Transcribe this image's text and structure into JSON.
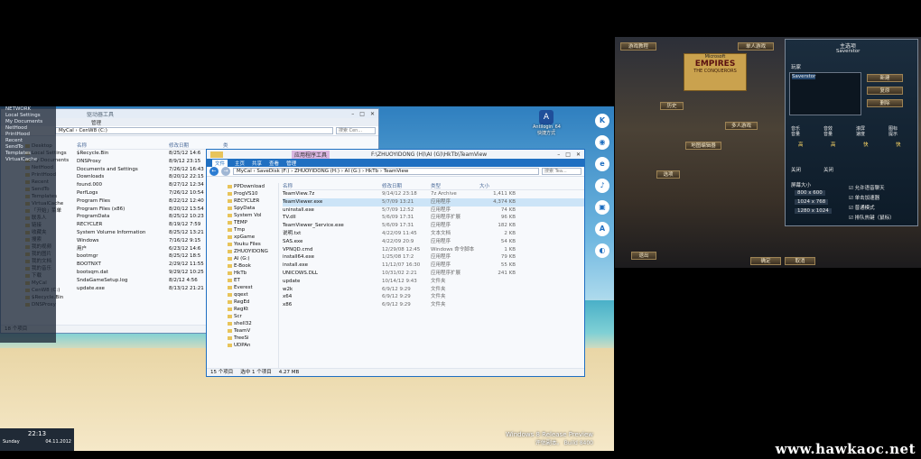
{
  "left_window": {
    "header_tools": "驱动器工具",
    "ribbon_tab_manage": "管理",
    "tree_root": "MyCal",
    "address_path": "CenW8 (C:)",
    "search_placeholder": "搜索 Cen...",
    "columns": [
      "名称",
      "修改日期",
      "类"
    ],
    "rows": [
      {
        "name": "$Recycle.Bin",
        "date": "8/25/12 14:6"
      },
      {
        "name": "DNSProxy",
        "date": "8/9/12 23:15"
      },
      {
        "name": "Documents and Settings",
        "date": "7/26/12 16:43"
      },
      {
        "name": "Downloads",
        "date": "8/20/12 22:15"
      },
      {
        "name": "found.000",
        "date": "8/27/12 12:34"
      },
      {
        "name": "PerfLogs",
        "date": "7/26/12 10:54"
      },
      {
        "name": "Program Files",
        "date": "8/22/12 12:40"
      },
      {
        "name": "Program Files (x86)",
        "date": "8/20/12 13:54"
      },
      {
        "name": "ProgramData",
        "date": "8/25/12 10:23"
      },
      {
        "name": "RECYCLER",
        "date": "8/19/12 7:59"
      },
      {
        "name": "System Volume Information",
        "date": "8/25/12 13:21"
      },
      {
        "name": "Windows",
        "date": "7/16/12 9:15"
      },
      {
        "name": "用户",
        "date": "6/23/12 14:6"
      },
      {
        "name": "bootmgr",
        "date": "8/25/12 18:5"
      },
      {
        "name": "BOOTNXT",
        "date": "2/29/12 11:55"
      },
      {
        "name": "bootsqm.dat",
        "date": "9/29/12 10:25"
      },
      {
        "name": "SndaGameSetup.log",
        "date": "8/2/12 4:56"
      },
      {
        "name": "update.exe",
        "date": "8/13/12 21:21"
      }
    ],
    "tree": [
      "Desktop",
      "Local Settings",
      "My Documents",
      "NetHood",
      "PrintHood",
      "Recent",
      "SendTo",
      "Templates",
      "VirtualCache",
      "「开始」菜单",
      "联系人",
      "链接",
      "收藏夹",
      "搜索",
      "我的视频",
      "我的图片",
      "我的文档",
      "我的音乐",
      "下载",
      "MyCal",
      "CenW8 (C:)",
      "$Recycle.Bin",
      "DNSProxy"
    ],
    "status": "18 个项目"
  },
  "dark_overlay": [
    "NETWORK",
    "Local Settings",
    "My Documents",
    "NetHood",
    "PrintHood",
    "Recent",
    "SendTo",
    "Templates",
    "VirtualCache"
  ],
  "main_window": {
    "title": "F:\\ZHUOYIDONG (H)\\AI (G)\\HkTb\\TeamView",
    "context_tab": "应用程序工具",
    "tabs": [
      "文件",
      "主页",
      "共享",
      "查看",
      "管理"
    ],
    "breadcrumb": [
      "MyCal",
      "SaveDisk (F:)",
      "ZHUOYIDONG (H:)",
      "AI (G:)",
      "HkTb",
      "TeamView"
    ],
    "search_placeholder": "搜索 Tea...",
    "columns": [
      "名称",
      "修改日期",
      "类型",
      "大小"
    ],
    "rows": [
      {
        "name": "TeamView.7z",
        "date": "9/14/12 23:18",
        "type": "7z Archive",
        "size": "1,411 KB"
      },
      {
        "name": "TeamViewer.exe",
        "date": "5/7/09 13:21",
        "type": "应用程序",
        "size": "4,374 KB"
      },
      {
        "name": "uninstall.exe",
        "date": "5/7/09 12:52",
        "type": "应用程序",
        "size": "74 KB"
      },
      {
        "name": "TV.dll",
        "date": "5/6/09 17:31",
        "type": "应用程序扩展",
        "size": "96 KB"
      },
      {
        "name": "TeamViewer_Service.exe",
        "date": "5/6/09 17:31",
        "type": "应用程序",
        "size": "182 KB"
      },
      {
        "name": "说明.txt",
        "date": "4/22/09 11:45",
        "type": "文本文档",
        "size": "2 KB"
      },
      {
        "name": "SAS.exe",
        "date": "4/22/09 20:9",
        "type": "应用程序",
        "size": "54 KB"
      },
      {
        "name": "VPNQD.cmd",
        "date": "12/29/08 12:45",
        "type": "Windows 命令脚本",
        "size": "1 KB"
      },
      {
        "name": "install64.exe",
        "date": "1/25/08 17:2",
        "type": "应用程序",
        "size": "79 KB"
      },
      {
        "name": "install.exe",
        "date": "11/12/07 16:30",
        "type": "应用程序",
        "size": "55 KB"
      },
      {
        "name": "UNICOWS.DLL",
        "date": "10/31/02 2:21",
        "type": "应用程序扩展",
        "size": "241 KB"
      },
      {
        "name": "update",
        "date": "10/14/12 9:43",
        "type": "文件夹",
        "size": ""
      },
      {
        "name": "w2k",
        "date": "6/9/12 9:29",
        "type": "文件夹",
        "size": ""
      },
      {
        "name": "x64",
        "date": "6/9/12 9:29",
        "type": "文件夹",
        "size": ""
      },
      {
        "name": "x86",
        "date": "6/9/12 9:29",
        "type": "文件夹",
        "size": ""
      }
    ],
    "tree": [
      "PPDownload",
      "ProgVS10",
      "RECYCLER",
      "SpyData",
      "System Vol",
      "TEMP",
      "Tmp",
      "xpGame",
      "Youku Files",
      "ZHUOYIDONG",
      "AI (G:)",
      "E-Book",
      "HkTb",
      "ET",
      "Everest",
      "qqext",
      "RegEd",
      "RegKt",
      "Scr",
      "shell32",
      "TeamV",
      "TreeSi",
      "UDPAn"
    ],
    "status_items": "15 个项目",
    "status_selected": "选中 1 个项目",
    "status_size": "4.27 MB"
  },
  "desktop_icon_label": "Antilogin_64 快捷方式",
  "clock": {
    "time": "22:13",
    "day": "Sunday",
    "date": "04.11.2012"
  },
  "windows_brand": {
    "line1": "Windows 8 Release Preview",
    "line2": "评估副本。 Build 8400"
  },
  "charms": [
    "K",
    "◉",
    "e",
    "♪",
    "▣",
    "A",
    "◐"
  ],
  "game": {
    "top_left": "游戏教程",
    "single": "单人游戏",
    "multi": "多人游戏",
    "history": "历史",
    "editor": "地图编辑器",
    "options": "选项",
    "exit": "退出",
    "main_title": "主选项",
    "player_sub": "Saverstor",
    "player_label": "玩家",
    "player_name": "Saverstor",
    "btn_new": "新建",
    "btn_copy": "复原",
    "btn_delete": "删除",
    "logo_top": "Microsoft",
    "logo_mid": "EMPIRES",
    "logo_sub": "THE CONQUERORS",
    "settings": [
      "音乐\n音量",
      "音效\n音量",
      "滚屏\n速度",
      "图标\n提示"
    ],
    "levels": [
      "高",
      "高",
      "快",
      "快"
    ],
    "toggles": [
      "关闭",
      "关闭"
    ],
    "resolution_label": "屏幕大小",
    "resolutions": [
      "800 x 600",
      "1024 x 768",
      "1280 x 1024"
    ],
    "checks": [
      "允许语音聊天",
      "单击加速器",
      "普通模式",
      "排队热键（鼠标）"
    ],
    "ok": "确定",
    "cancel": "取消"
  },
  "watermark": "www.hawkaoc.net"
}
